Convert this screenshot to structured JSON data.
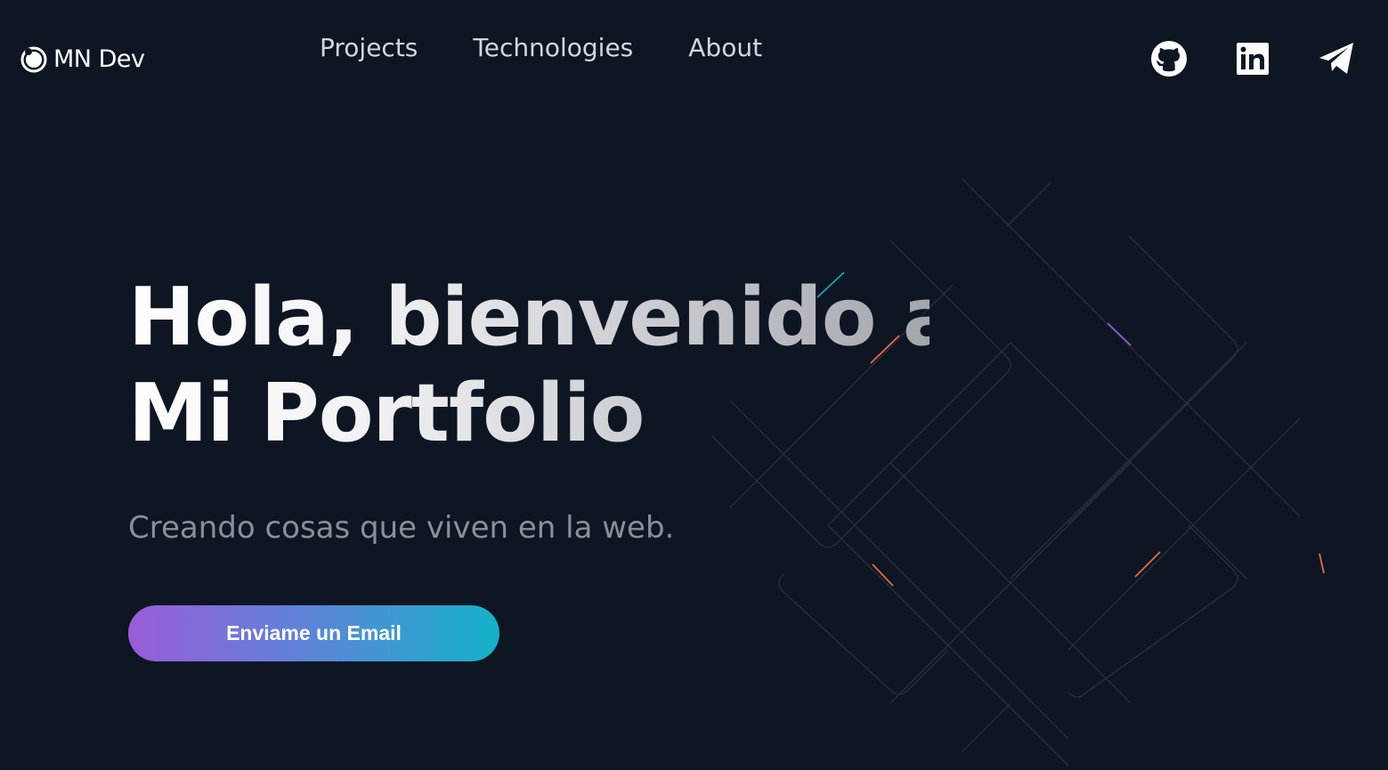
{
  "header": {
    "logo_text": "MN Dev",
    "nav": [
      {
        "label": "Projects"
      },
      {
        "label": "Technologies"
      },
      {
        "label": "About"
      }
    ],
    "social": [
      {
        "icon": "github-icon"
      },
      {
        "icon": "linkedin-icon"
      },
      {
        "icon": "telegram-icon"
      }
    ]
  },
  "hero": {
    "title_line1": "Hola, bienvenido a",
    "title_line2": "Mi Portfolio",
    "subtitle": "Creando cosas que viven en la web.",
    "cta_label": "Enviame un Email"
  },
  "colors": {
    "background": "#0f1623",
    "cta_gradient_start": "#9a5cd8",
    "cta_gradient_end": "#14b2c8"
  }
}
